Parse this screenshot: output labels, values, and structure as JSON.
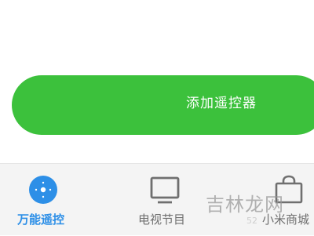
{
  "main": {
    "add_remote_label": "添加遥控器"
  },
  "tabs": [
    {
      "label": "万能遥控",
      "icon": "remote-icon",
      "active": true
    },
    {
      "label": "电视节目",
      "icon": "tv-icon",
      "active": false
    },
    {
      "label": "小米商城",
      "icon": "shopping-bag-icon",
      "active": false
    }
  ],
  "watermark": {
    "text": "吉林龙网",
    "subtext": "52"
  },
  "colors": {
    "accent_green": "#3cc13c",
    "active_blue": "#2d8fe7",
    "inactive_gray": "#6f6f6f",
    "tab_bar_bg": "#f4f4f4"
  }
}
